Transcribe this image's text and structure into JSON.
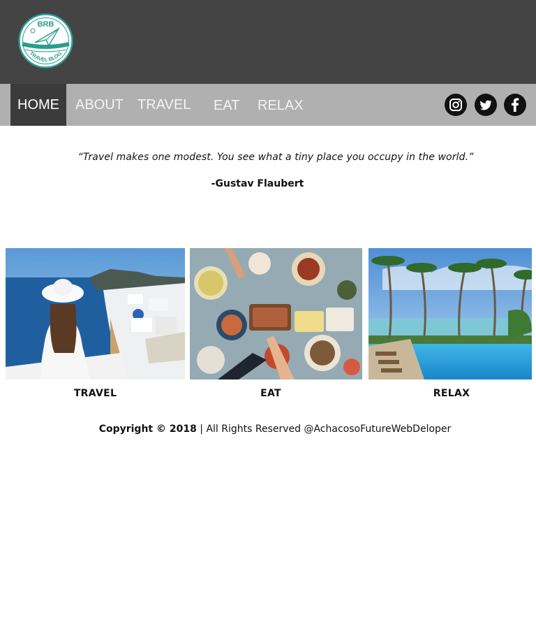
{
  "logo": {
    "top_text": "BRB",
    "bottom_text": "TRAVEL BLOG",
    "accent_color": "#2a9d8f"
  },
  "nav": {
    "items": [
      {
        "label": "HOME",
        "active": true
      },
      {
        "label": "ABOUT",
        "active": false
      },
      {
        "label": "TRAVEL",
        "active": false
      },
      {
        "label": "EAT",
        "active": false
      },
      {
        "label": "RELAX",
        "active": false
      }
    ],
    "social": [
      "instagram-icon",
      "twitter-icon",
      "facebook-icon"
    ]
  },
  "quote": {
    "text": "“Travel makes one modest. You see what a tiny place you occupy in the world.”",
    "author": "-Gustav Flaubert"
  },
  "cards": [
    {
      "label": "TRAVEL",
      "image": "santorini-woman-photo"
    },
    {
      "label": "EAT",
      "image": "food-table-photo"
    },
    {
      "label": "RELAX",
      "image": "palm-pool-photo"
    }
  ],
  "footer": {
    "copyright": "Copyright © 2018",
    "rights": " | All Rights Reserved @AchacosoFutureWebDeloper"
  },
  "colors": {
    "header_bg": "#444444",
    "nav_bg": "#b0b0b0",
    "active_nav_bg": "#3b3b3b"
  }
}
